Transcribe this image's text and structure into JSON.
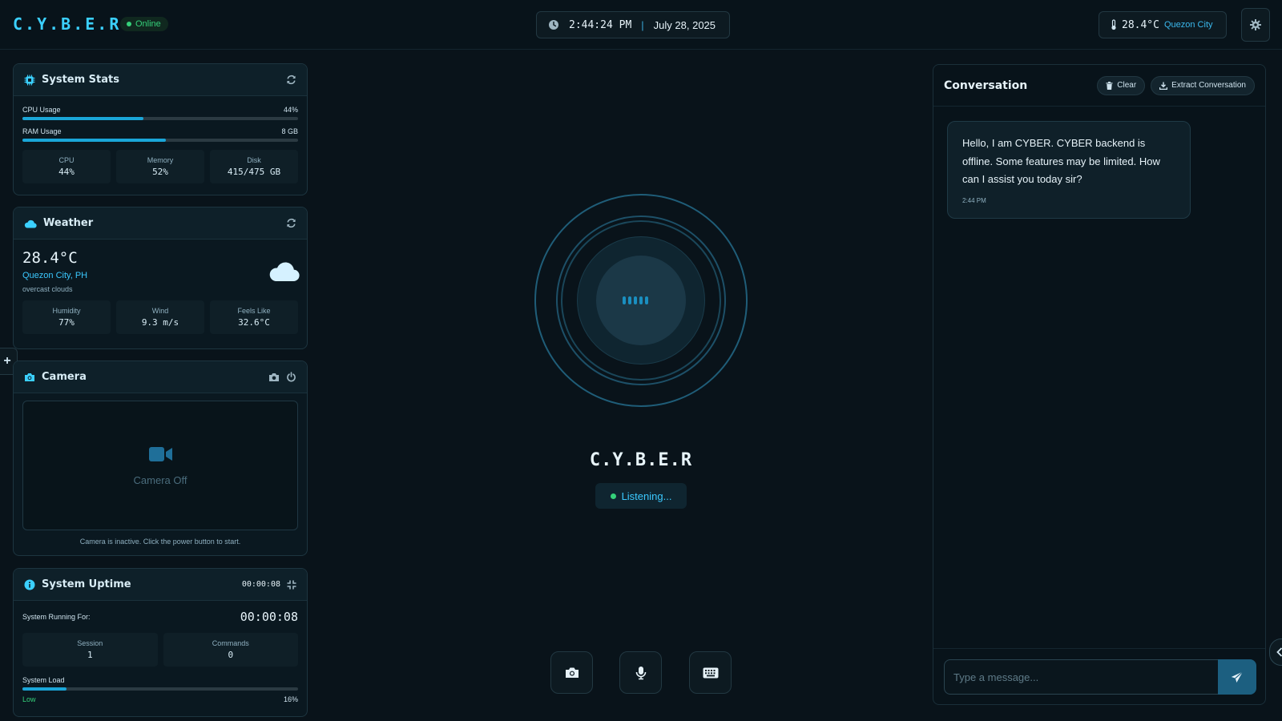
{
  "header": {
    "brand": "C.Y.B.E.R",
    "status": "Online",
    "time": "2:44:24 PM",
    "separator": "|",
    "date": "July 28, 2025",
    "temp": "28.4°C",
    "city": "Quezon City"
  },
  "system_stats": {
    "title": "System Stats",
    "cpu_label": "CPU Usage",
    "cpu_value": "44%",
    "cpu_fraction": 0.44,
    "ram_label": "RAM Usage",
    "ram_value": "8 GB",
    "ram_fraction": 0.52,
    "tiles": [
      {
        "label": "CPU",
        "value": "44%"
      },
      {
        "label": "Memory",
        "value": "52%"
      },
      {
        "label": "Disk",
        "value": "415/475 GB"
      }
    ]
  },
  "weather": {
    "title": "Weather",
    "temp": "28.4°C",
    "location": "Quezon City, PH",
    "desc": "overcast clouds",
    "tiles": [
      {
        "label": "Humidity",
        "value": "77%"
      },
      {
        "label": "Wind",
        "value": "9.3 m/s"
      },
      {
        "label": "Feels Like",
        "value": "32.6°C"
      }
    ]
  },
  "camera": {
    "title": "Camera",
    "off_text": "Camera Off",
    "hint": "Camera is inactive. Click the power button to start."
  },
  "uptime": {
    "title": "System Uptime",
    "header_time": "00:00:08",
    "running_label": "System Running For:",
    "running_value": "00:00:08",
    "tiles": [
      {
        "label": "Session",
        "value": "1"
      },
      {
        "label": "Commands",
        "value": "0"
      }
    ],
    "load_label": "System Load",
    "load_level": "Low",
    "load_value": "16%",
    "load_fraction": 0.16
  },
  "center": {
    "title": "C.Y.B.E.R",
    "status": "Listening..."
  },
  "conversation": {
    "title": "Conversation",
    "clear_label": "Clear",
    "extract_label": "Extract Conversation",
    "messages": [
      {
        "text": "Hello, I am CYBER. CYBER backend is offline. Some features may be limited. How can I assist you today sir?",
        "time": "2:44 PM"
      }
    ],
    "input_placeholder": "Type a message..."
  },
  "colors": {
    "accent": "#3bd0ff",
    "online": "#35d17a",
    "background": "#09131a",
    "bar_fill": "#1aa6d8"
  }
}
